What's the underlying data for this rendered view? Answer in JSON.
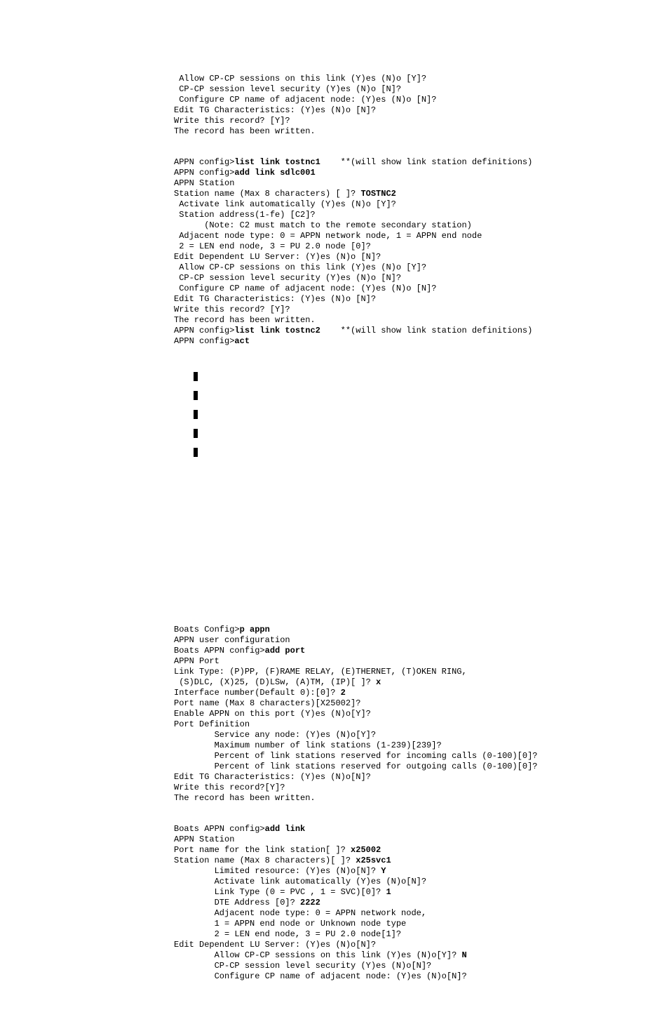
{
  "block1": {
    "l1": " Allow CP-CP sessions on this link (Y)es (N)o [Y]?",
    "l2": " CP-CP session level security (Y)es (N)o [N]?",
    "l3": " Configure CP name of adjacent node: (Y)es (N)o [N]?",
    "l4": "Edit TG Characteristics: (Y)es (N)o [N]?",
    "l5": "Write this record? [Y]?",
    "l6": "The record has been written."
  },
  "block2": {
    "l1a": "APPN config>",
    "l1b": "list link tostnc1",
    "l1c": "    **(will show link station definitions)",
    "l2a": "APPN config>",
    "l2b": "add link sdlc001",
    "l3": "APPN Station",
    "l4a": "Station name (Max 8 characters) [ ]? ",
    "l4b": "TOSTNC2",
    "l5": " Activate link automatically (Y)es (N)o [Y]?",
    "l6": " Station address(1-fe) [C2]?",
    "l7": "      (Note: C2 must match to the remote secondary station)",
    "l8": " Adjacent node type: 0 = APPN network node, 1 = APPN end node",
    "l9": " 2 = LEN end node, 3 = PU 2.0 node [0]?",
    "l10": "Edit Dependent LU Server: (Y)es (N)o [N]?",
    "l11": " Allow CP-CP sessions on this link (Y)es (N)o [Y]?",
    "l12": " CP-CP session level security (Y)es (N)o [N]?",
    "l13": " Configure CP name of adjacent node: (Y)es (N)o [N]?",
    "l14": "Edit TG Characteristics: (Y)es (N)o [N]?",
    "l15": "Write this record? [Y]?",
    "l16": "The record has been written.",
    "l17a": "APPN config>",
    "l17b": "list link tostnc2",
    "l17c": "    **(will show link station definitions)",
    "l18a": "APPN config>",
    "l18b": "act"
  },
  "block3": {
    "l1a": "Boats Config>",
    "l1b": "p appn",
    "l2": "APPN user configuration",
    "l3a": "Boats APPN config>",
    "l3b": "add port",
    "l4": "APPN Port",
    "l5": "Link Type: (P)PP, (F)RAME RELAY, (E)THERNET, (T)OKEN RING,",
    "l6a": " (S)DLC, (X)25, (D)LSw, (A)TM, (IP)[ ]? ",
    "l6b": "x",
    "l7a": "Interface number(Default 0):[0]? ",
    "l7b": "2",
    "l8": "Port name (Max 8 characters)[X25002]?",
    "l9": "Enable APPN on this port (Y)es (N)o[Y]?",
    "l10": "Port Definition",
    "l11": "        Service any node: (Y)es (N)o[Y]?",
    "l12": "        Maximum number of link stations (1-239)[239]?",
    "l13": "        Percent of link stations reserved for incoming calls (0-100)[0]?",
    "l14": "        Percent of link stations reserved for outgoing calls (0-100)[0]?",
    "l15": "Edit TG Characteristics: (Y)es (N)o[N]?",
    "l16": "Write this record?[Y]?",
    "l17": "The record has been written."
  },
  "block4": {
    "l1a": "Boats APPN config>",
    "l1b": "add link",
    "l2": "APPN Station",
    "l3a": "Port name for the link station[ ]? ",
    "l3b": "x25002",
    "l4a": "Station name (Max 8 characters)[ ]? ",
    "l4b": "x25svc1",
    "l5a": "        Limited resource: (Y)es (N)o[N]? ",
    "l5b": "Y",
    "l6": "        Activate link automatically (Y)es (N)o[N]?",
    "l7a": "        Link Type (0 = PVC , 1 = SVC)[0]? ",
    "l7b": "1",
    "l8a": "        DTE Address [0]? ",
    "l8b": "2222",
    "l9": "        Adjacent node type: 0 = APPN network node,",
    "l10": "        1 = APPN end node or Unknown node type",
    "l11": "        2 = LEN end node, 3 = PU 2.0 node[1]?",
    "l12": "Edit Dependent LU Server: (Y)es (N)o[N]?",
    "l13a": "        Allow CP-CP sessions on this link (Y)es (N)o[Y]? ",
    "l13b": "N",
    "l14": "        CP-CP session level security (Y)es (N)o[N]?",
    "l15": "        Configure CP name of adjacent node: (Y)es (N)o[N]?"
  }
}
